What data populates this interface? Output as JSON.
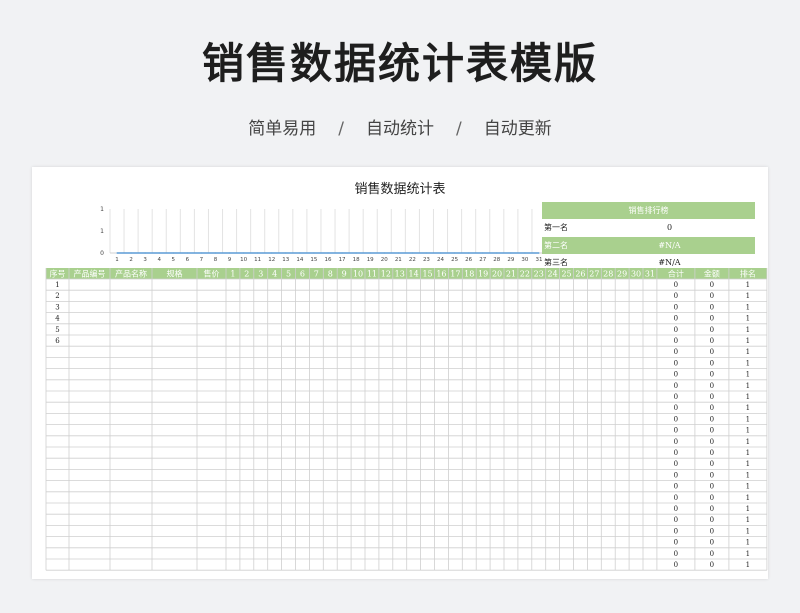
{
  "hero": {
    "title": "销售数据统计表模版",
    "subtitle_items": [
      "简单易用",
      "自动统计",
      "自动更新"
    ],
    "separator": "/"
  },
  "sheet": {
    "title": "销售数据统计表",
    "ranking": {
      "header": "销售排行榜",
      "rows": [
        {
          "label": "第一名",
          "value": "0"
        },
        {
          "label": "第二名",
          "value": "#N/A"
        },
        {
          "label": "第三名",
          "value": "#N/A"
        }
      ]
    },
    "table": {
      "headers_left": [
        "序号",
        "产品编号",
        "产品名称",
        "规格",
        "售价"
      ],
      "day_columns": [
        "1",
        "2",
        "3",
        "4",
        "5",
        "6",
        "7",
        "8",
        "9",
        "10",
        "11",
        "12",
        "13",
        "14",
        "15",
        "16",
        "17",
        "18",
        "19",
        "20",
        "21",
        "22",
        "23",
        "24",
        "25",
        "26",
        "27",
        "28",
        "29",
        "30",
        "31"
      ],
      "headers_right": [
        "合计",
        "金额",
        "排名"
      ],
      "row_numbers": [
        "1",
        "2",
        "3",
        "4",
        "5",
        "6"
      ],
      "total_value": "0",
      "amount_value": "0",
      "rank_value": "1",
      "visible_rows": 26
    }
  },
  "chart_data": {
    "type": "line",
    "x": [
      1,
      2,
      3,
      4,
      5,
      6,
      7,
      8,
      9,
      10,
      11,
      12,
      13,
      14,
      15,
      16,
      17,
      18,
      19,
      20,
      21,
      22,
      23,
      24,
      25,
      26,
      27,
      28,
      29,
      30,
      31
    ],
    "series": [
      {
        "values": [
          0,
          0,
          0,
          0,
          0,
          0,
          0,
          0,
          0,
          0,
          0,
          0,
          0,
          0,
          0,
          0,
          0,
          0,
          0,
          0,
          0,
          0,
          0,
          0,
          0,
          0,
          0,
          0,
          0,
          0,
          0
        ]
      }
    ],
    "y_tick_labels": [
      "0",
      "1",
      "1"
    ],
    "ylim": [
      0,
      1
    ],
    "grid": true,
    "colors": {
      "line": "#5b9bd5",
      "grid": "#e3e3e3"
    }
  },
  "colors": {
    "header_green": "#a9d08e",
    "border": "#cfcfcf"
  }
}
